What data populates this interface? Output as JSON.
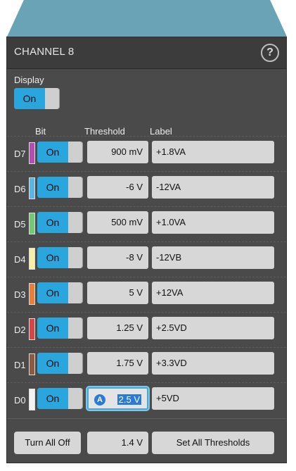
{
  "panel": {
    "title": "CHANNEL 8",
    "help_label": "?",
    "display_label": "Display",
    "display_toggle": "On"
  },
  "columns": {
    "bit": "Bit",
    "threshold": "Threshold",
    "label": "Label"
  },
  "channels": [
    {
      "name": "D7",
      "toggle": "On",
      "threshold": "900 mV",
      "label": "+1.8VA",
      "color": "#b34fb3"
    },
    {
      "name": "D6",
      "toggle": "On",
      "threshold": "-6 V",
      "label": "-12VA",
      "color": "#5bb6e6"
    },
    {
      "name": "D5",
      "toggle": "On",
      "threshold": "500 mV",
      "label": "+1.0VA",
      "color": "#74c877"
    },
    {
      "name": "D4",
      "toggle": "On",
      "threshold": "-8 V",
      "label": "-12VB",
      "color": "#f5f0a5"
    },
    {
      "name": "D3",
      "toggle": "On",
      "threshold": "5 V",
      "label": "+12VA",
      "color": "#e8803c"
    },
    {
      "name": "D2",
      "toggle": "On",
      "threshold": "1.25 V",
      "label": "+2.5VD",
      "color": "#d64646"
    },
    {
      "name": "D1",
      "toggle": "On",
      "threshold": "1.75 V",
      "label": "+3.3VD",
      "color": "#8a5a43"
    },
    {
      "name": "D0",
      "toggle": "On",
      "threshold": "2.5 V",
      "label": "+5VD",
      "color": "#f3f3f3",
      "badge": "A"
    }
  ],
  "footer": {
    "turn_all_off": "Turn All Off",
    "all_threshold": "1.4 V",
    "set_all_thresholds": "Set All Thresholds"
  },
  "colors": {
    "accent": "#2aa6df",
    "panel": "#4a4a4a",
    "header_tab": "#6aa2b6"
  }
}
